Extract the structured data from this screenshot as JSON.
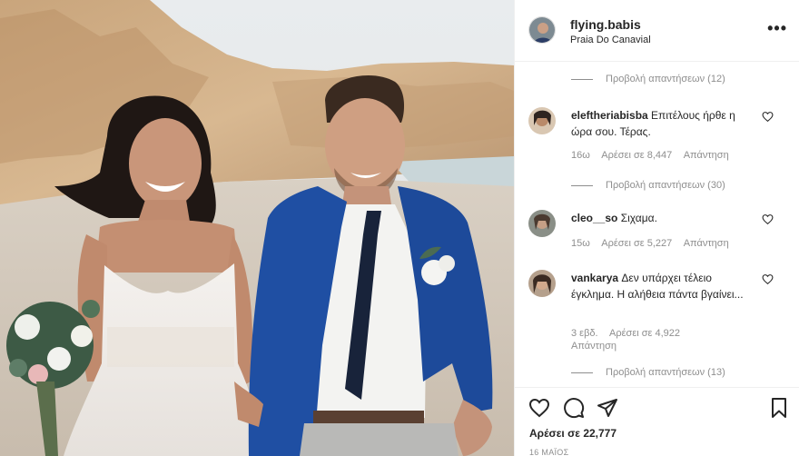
{
  "header": {
    "username": "flying.babis",
    "location": "Praia Do Canavial",
    "more_icon": "more-options-icon"
  },
  "comments": {
    "replies_1": "Προβολή απαντήσεων (12)",
    "items": [
      {
        "username": "eleftheriabisba",
        "text": "Επιτέλους ήρθε η ώρα σου. Τέρας.",
        "time": "16ω",
        "likes": "Αρέσει σε 8,447",
        "reply": "Απάντηση",
        "replies": "Προβολή απαντήσεων (30)"
      },
      {
        "username": "cleo__so",
        "text": "Σιχαμα.",
        "time": "15ω",
        "likes": "Αρέσει σε 5,227",
        "reply": "Απάντηση"
      },
      {
        "username": "vankarya",
        "text": "Δεν υπάρχει τέλειο έγκλημα. Η αλήθεια πάντα βγαίνει...",
        "time": "3 εβδ.",
        "likes": "Αρέσει σε 4,922",
        "reply": "Απάντηση",
        "replies": "Προβολή απαντήσεων (13)"
      }
    ]
  },
  "actions": {
    "icons": [
      "heart-icon",
      "comment-icon",
      "share-icon",
      "bookmark-icon"
    ],
    "likes": "Αρέσει σε 22,777",
    "date": "16 ΜΑΪΟΣ"
  },
  "colors": {
    "text": "#262626",
    "secondary": "#8e8e8e",
    "border": "#efefef",
    "suit_blue": "#1f4fa3"
  }
}
